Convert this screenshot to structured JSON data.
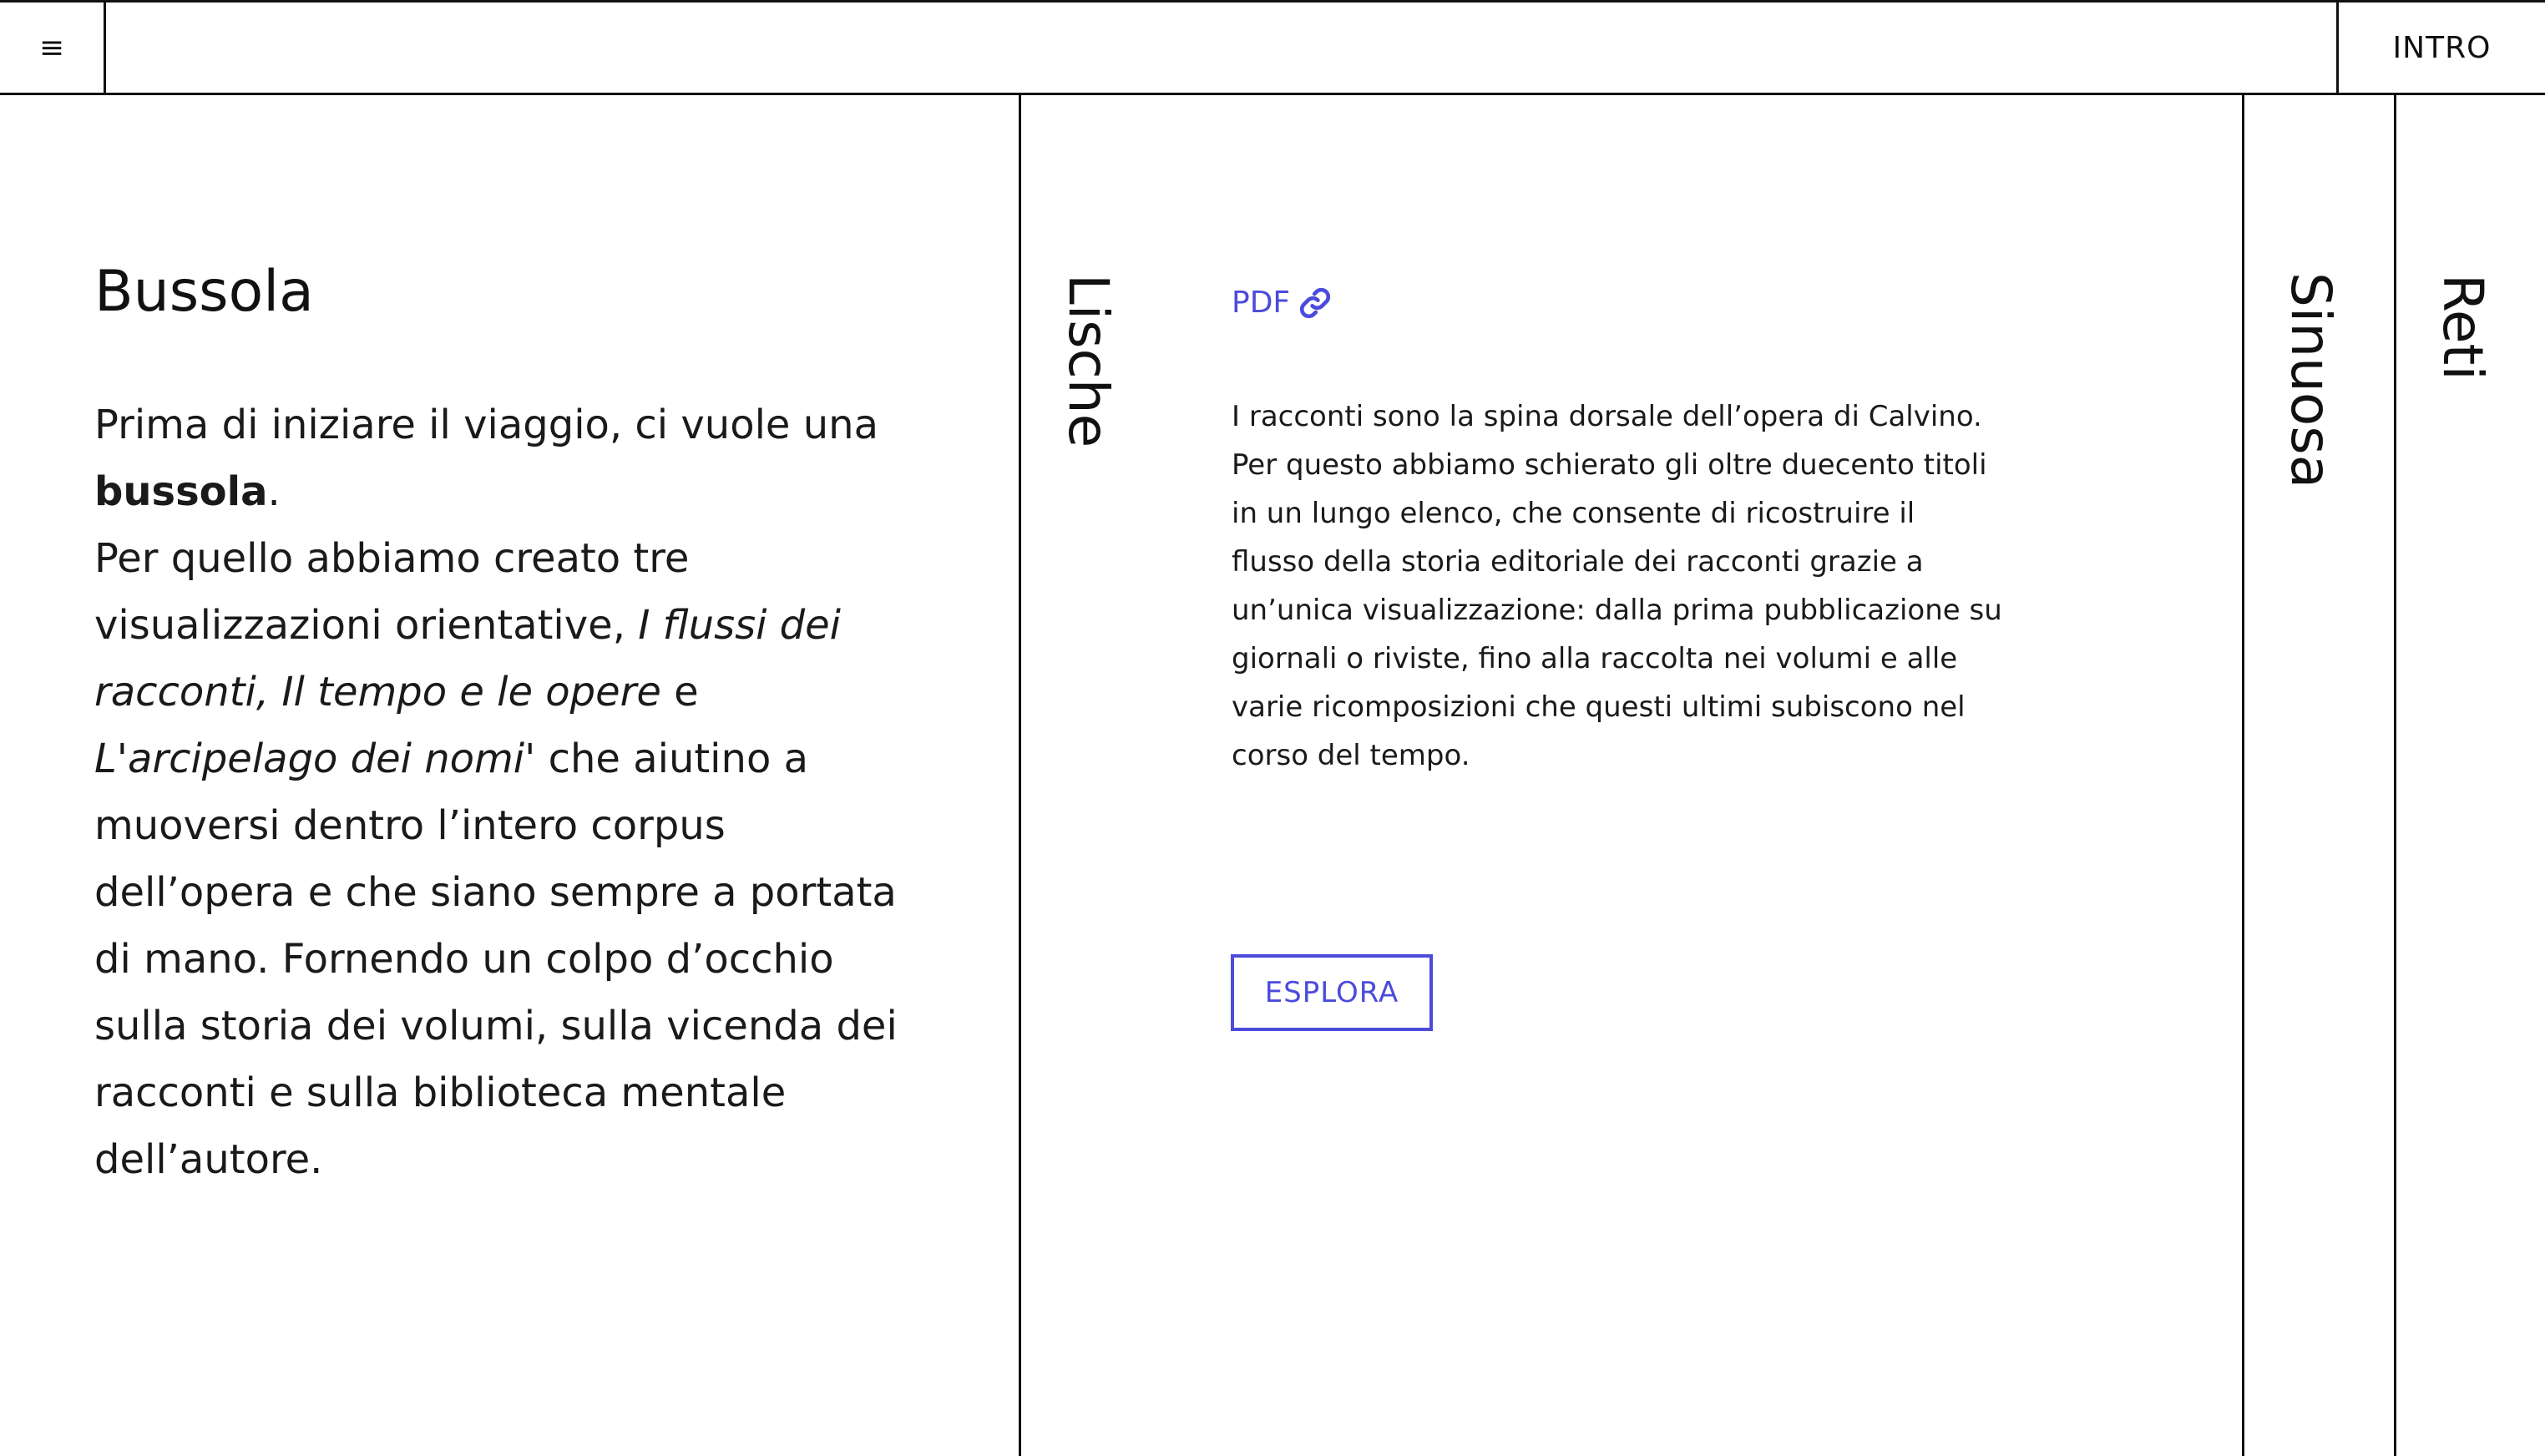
{
  "header": {
    "menu_icon": "≡",
    "intro_label": "INTRO"
  },
  "bussola": {
    "title": "Bussola",
    "p1_before": "Prima di iniziare il viaggio, ci vuole una ",
    "p1_bold": "bussola",
    "p1_after": ".",
    "p2_before": "Per quello abbiamo creato tre visualizzazioni orientative, ",
    "p2_italic1": "I flussi dei racconti, Il tempo e le opere",
    "p2_mid": " e ",
    "p2_italic2": "L'arcipelago dei nomi'",
    "p2_after": " che aiutino a muoversi dentro l’intero corpus dell’opera e che siano sempre a portata di mano. Fornendo un colpo d’occhio sulla storia dei volumi, sulla vicenda dei racconti e sulla biblioteca mentale dell’autore."
  },
  "tabs": {
    "lische": "Lische",
    "sinuosa": "Sinuosa",
    "reti": "Reti"
  },
  "lische": {
    "pdf_label": "PDF",
    "pdf_icon": "link-icon",
    "description": "I racconti sono la spina dorsale dell’opera di Calvino. Per questo abbiamo schierato gli oltre duecento titoli in un lungo elenco, che consente di ricostruire il flusso della storia editoriale dei racconti grazie a un’unica visualizzazione: dalla prima pubblicazione su giornali o riviste, fino alla raccolta nei volumi e alle varie ricomposizioni che questi ultimi subiscono nel corso del tempo.",
    "explore_label": "ESPLORA"
  },
  "colors": {
    "accent": "#4b4bdc",
    "line": "#111111"
  }
}
